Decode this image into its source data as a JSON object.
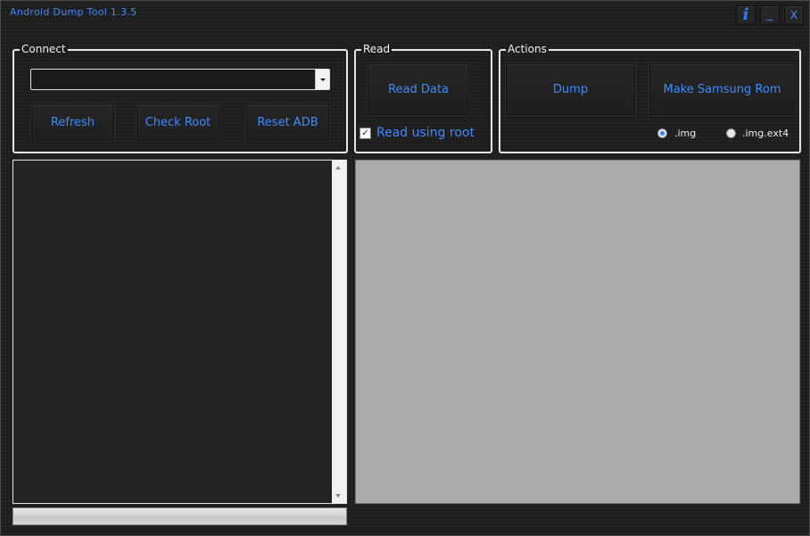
{
  "window": {
    "title": "Android Dump Tool 1.3.5",
    "info_label": "i",
    "minimize_label": "_",
    "close_label": "X"
  },
  "connect": {
    "legend": "Connect",
    "device_select_value": "",
    "refresh_label": "Refresh",
    "check_root_label": "Check Root",
    "reset_adb_label": "Reset ADB"
  },
  "read": {
    "legend": "Read",
    "read_data_label": "Read Data",
    "read_using_root_label": "Read using root",
    "read_using_root_checked": true,
    "checkbox_mark": "✓"
  },
  "actions": {
    "legend": "Actions",
    "dump_label": "Dump",
    "make_samsung_rom_label": "Make Samsung Rom",
    "format_options": [
      {
        "label": ".img",
        "selected": true
      },
      {
        "label": ".img.ext4",
        "selected": false
      }
    ]
  },
  "log_panel": {
    "text": ""
  },
  "progress": {
    "value": 0
  },
  "colors": {
    "accent": "#3d8cff",
    "background": "#1e1e1e",
    "data_panel": "#ababab"
  }
}
